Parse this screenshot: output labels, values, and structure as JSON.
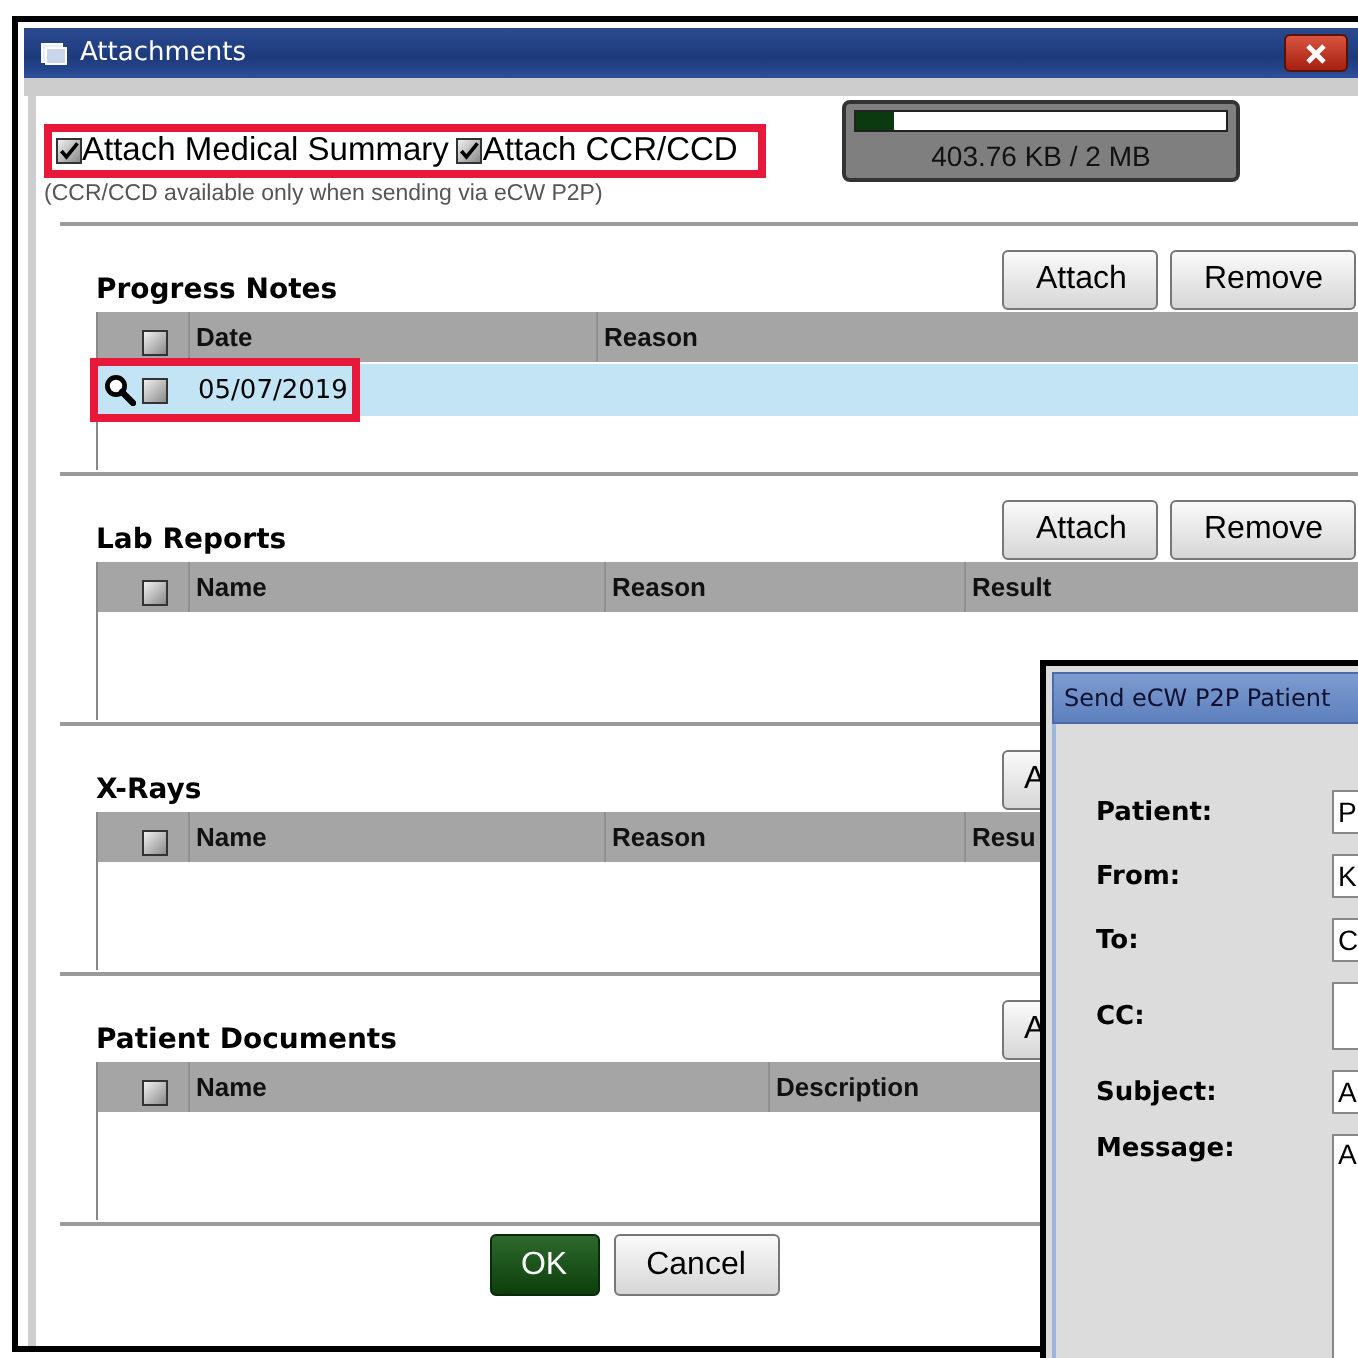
{
  "window": {
    "title": "Attachments"
  },
  "options": [
    {
      "label": "Attach Medical Summary",
      "checked": true
    },
    {
      "label": "Attach CCR/CCD",
      "checked": true
    }
  ],
  "options_note": "(CCR/CCD available only when sending via eCW P2P)",
  "storage": {
    "level": 0.1,
    "reading": "403.76 KB / 2 MB"
  },
  "sections": [
    {
      "title": "Progress Notes",
      "buttons": [
        "Attach",
        "Remove"
      ],
      "columns": [
        "Date",
        "Reason"
      ],
      "select_all_checked": false,
      "rows": [
        {
          "cells": [
            "05/07/2019"
          ],
          "checked": false,
          "selected": true
        }
      ]
    },
    {
      "title": "Lab Reports",
      "buttons": [
        "Attach",
        "Remove"
      ],
      "columns": [
        "Name",
        "Reason",
        "Result"
      ],
      "select_all_checked": false
    },
    {
      "title": "X-Rays",
      "buttons": [
        "A"
      ],
      "columns": [
        "Name",
        "Reason",
        "Resu"
      ],
      "select_all_checked": false
    },
    {
      "title": "Patient Documents",
      "buttons": [
        "A"
      ],
      "columns": [
        "Name",
        "Description"
      ],
      "select_all_checked": false
    }
  ],
  "buttons": [
    {
      "label": "OK",
      "kind": "primary"
    },
    {
      "label": "Cancel",
      "kind": "secondary"
    }
  ],
  "overlay_window": {
    "title": "Send eCW P2P Patient",
    "fields": [
      {
        "label": "Patient:",
        "value": "P",
        "kind": "line"
      },
      {
        "label": "From:",
        "value": "K",
        "kind": "line"
      },
      {
        "label": "To:",
        "value": "C",
        "kind": "line"
      },
      {
        "label": "CC:",
        "kind": "box"
      },
      {
        "label": "Subject:",
        "value": "A",
        "kind": "line"
      },
      {
        "label": "Message:",
        "value": "A",
        "kind": "area"
      }
    ]
  }
}
